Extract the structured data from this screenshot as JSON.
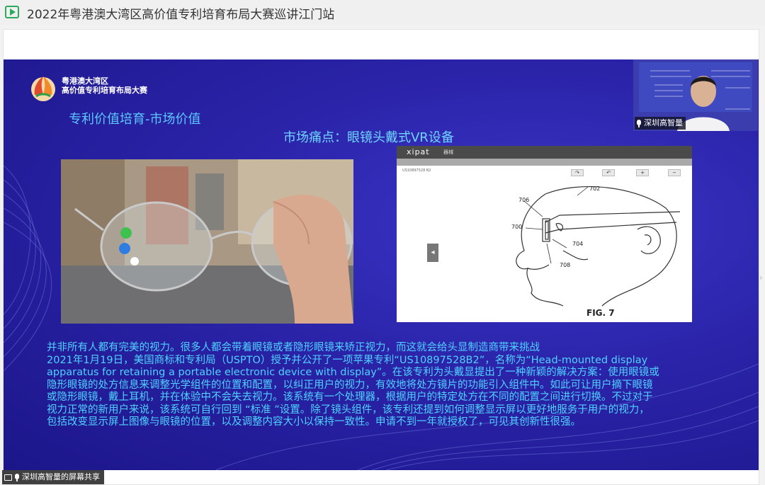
{
  "window": {
    "title": "2022年粤港澳大湾区高价值专利培育布局大赛巡讲江门站",
    "icon": "play-icon"
  },
  "slide": {
    "org_name_line1": "粤港澳大湾区",
    "org_name_line2": "高价值专利培育布局大赛",
    "section_title": "专利价值培育-市场价值",
    "heading": "市场痛点：眼镜头戴式VR设备",
    "patent_viewer": {
      "brand": "xipat",
      "tab_label": "器械",
      "patent_number": "US10897528 B2",
      "figure_label": "FIG. 7",
      "refs": [
        "702",
        "706",
        "700",
        "704",
        "708"
      ]
    },
    "body_lines": [
      "并非所有人都有完美的视力。很多人都会带着眼镜或者隐形眼镜来矫正视力，而这就会给头显制造商带来挑战",
      "2021年1月19日，美国商标和专利局（USPTO）授予并公开了一项苹果专利“US10897528B2”，名称为“Head-mounted display",
      "apparatus for retaining a portable electronic device with display”。在该专利为头戴显提出了一种新颖的解决方案：使用眼镜或",
      "隐形眼镜的处方信息来调整光学组件的位置和配置，以纠正用户的视力，有效地将处方镜片的功能引入组件中。如此可让用户摘下眼镜",
      "或隐形眼镜，戴上耳机，并在体验中不会失去视力。该系统有一个处理器，根据用户的特定处方在不同的配置之间进行切换。不过对于",
      "视力正常的新用户来说，该系统可自行回到 “标准 ”设置。除了镜头组件，该专利还提到如何调整显示屏以更好地服务于用户的视力，",
      "包括改变显示屏上图像与眼镜的位置，以及调整内容大小以保持一致性。申请不到一年就授权了，可见其创新性很强。"
    ]
  },
  "webcam": {
    "speaker_name": "深圳高智量"
  },
  "share_label": "深圳高智量的屏幕共享",
  "colors": {
    "slide_bg": "#2a23a8",
    "accent_text": "#4fd2ff",
    "title_icon": "#2daa5d"
  }
}
